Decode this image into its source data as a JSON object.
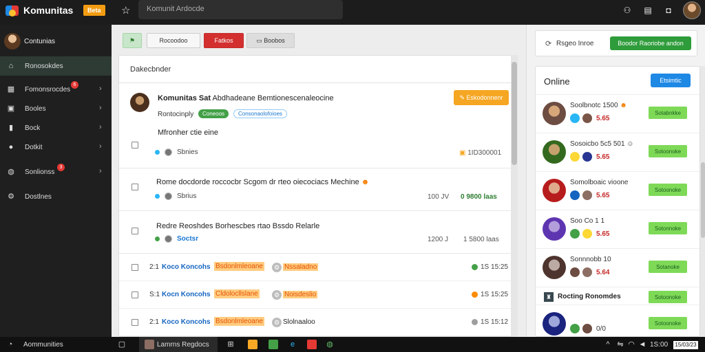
{
  "app": {
    "title": "Komunitas",
    "beta_badge": "Beta"
  },
  "search": {
    "placeholder": "Komunit Ardocde"
  },
  "sidebar": {
    "profile_name": "Contunias",
    "items": [
      {
        "label": "Ronosokdes",
        "icon": "home-icon",
        "active": true
      },
      {
        "label": "Fomonsrocdes",
        "icon": "briefcase-icon",
        "badge": "6"
      },
      {
        "label": "Booles",
        "icon": "image-icon"
      },
      {
        "label": "Bock",
        "icon": "book-icon"
      },
      {
        "label": "Dotkit",
        "icon": "circle-icon"
      },
      {
        "label": "Sonlionss",
        "icon": "chat-icon",
        "badge": "3"
      },
      {
        "label": "Dostlnes",
        "icon": "settings-icon"
      }
    ]
  },
  "toolbar": {
    "flag_icon": "flag-icon",
    "plain_label": "Rocoodoo",
    "red_label": "Fatkos",
    "grey_label": "Boobos"
  },
  "panel": {
    "title": "Dakecbnder"
  },
  "featured_post": {
    "author": "Komunitas Sat",
    "title_rest": "Abdhadeane Bemtionescenaleocine",
    "meta_label": "Rontocinply",
    "tag_green": "Coneoos",
    "tag_outline": "Consonaolofoioes",
    "action_label": "Eskodonnenr",
    "subject": "Mfronher ctie eine",
    "author_label": "Sbnies",
    "stat": "1ID300001"
  },
  "posts": [
    {
      "title": "Rome docdorde roccocbr Scgom dr rteo oiecociacs Mechine",
      "author_label": "Sbrius",
      "stat1": "100 JV",
      "stat2": "0 9800 laas"
    },
    {
      "title": "Redre Reoshdes Borhescbes rtao Bssdo Relarle",
      "author_label": "Soctsr",
      "stat1": "1200 J",
      "stat2": "1 5800 laas"
    }
  ],
  "list_rows": [
    {
      "num": "2:1",
      "name": "Koco Koncohs",
      "highlight": "Bsdonlmleoane",
      "label": "Nssaladno",
      "label_hl": true,
      "status_color": "#43a047",
      "time": "1S 15:25"
    },
    {
      "num": "S:1",
      "name": "Kocn Koncohs",
      "highlight": "Cldolocllslane",
      "label": "Noisdeslio",
      "label_hl": true,
      "status_color": "#fb8c00",
      "time": "1S 15:25"
    },
    {
      "num": "2:1",
      "name": "Koco Koncohs",
      "highlight": "Bsdonlmleoane",
      "label": "Slolnaaloo",
      "label_hl": false,
      "status_color": "#9e9e9e",
      "time": "1S 15:12"
    }
  ],
  "right_card": {
    "label": "Rsgeo Inroe",
    "button": "Boodor Raoriobe andon"
  },
  "online": {
    "title": "Online",
    "button": "Etsimtic",
    "rows": [
      {
        "name": "Soolbnotc 1500",
        "score": "5.65",
        "button": "Sotabnkke",
        "avatar_color": "#6d4c41"
      },
      {
        "name": "Sosoicbo 5c5 501",
        "score": "5.65",
        "button": "Sotoonoke",
        "avatar_color": "#33691e"
      },
      {
        "name": "Somolboaic vioone",
        "score": "5.65",
        "button": "Sotoonoke",
        "avatar_color": "#b71c1c"
      },
      {
        "name": "Soo Co 1 1",
        "score": "5.65",
        "button": "Sotonnoke",
        "avatar_color": "#5e35b1"
      },
      {
        "name": "Sonnnobb 10",
        "score": "5.64",
        "button": "Sotanoke",
        "avatar_color": "#4e342e"
      }
    ],
    "sub_row": {
      "label": "Rocting Ronomdes",
      "button": "Sotoonoke"
    },
    "last_row": {
      "name": "",
      "score": "0/0",
      "button": "Sotoonoke",
      "avatar_color": "#1a237e"
    }
  },
  "taskbar": {
    "left_label": "Aommunities",
    "app_label": "Lamrns Regdocs",
    "time": "1S:00",
    "date": "15/03/23"
  },
  "colors": {
    "accent_green": "#2e9c3a",
    "accent_blue": "#1e88e5",
    "accent_red": "#d32f2f",
    "accent_orange": "#f5a623"
  }
}
